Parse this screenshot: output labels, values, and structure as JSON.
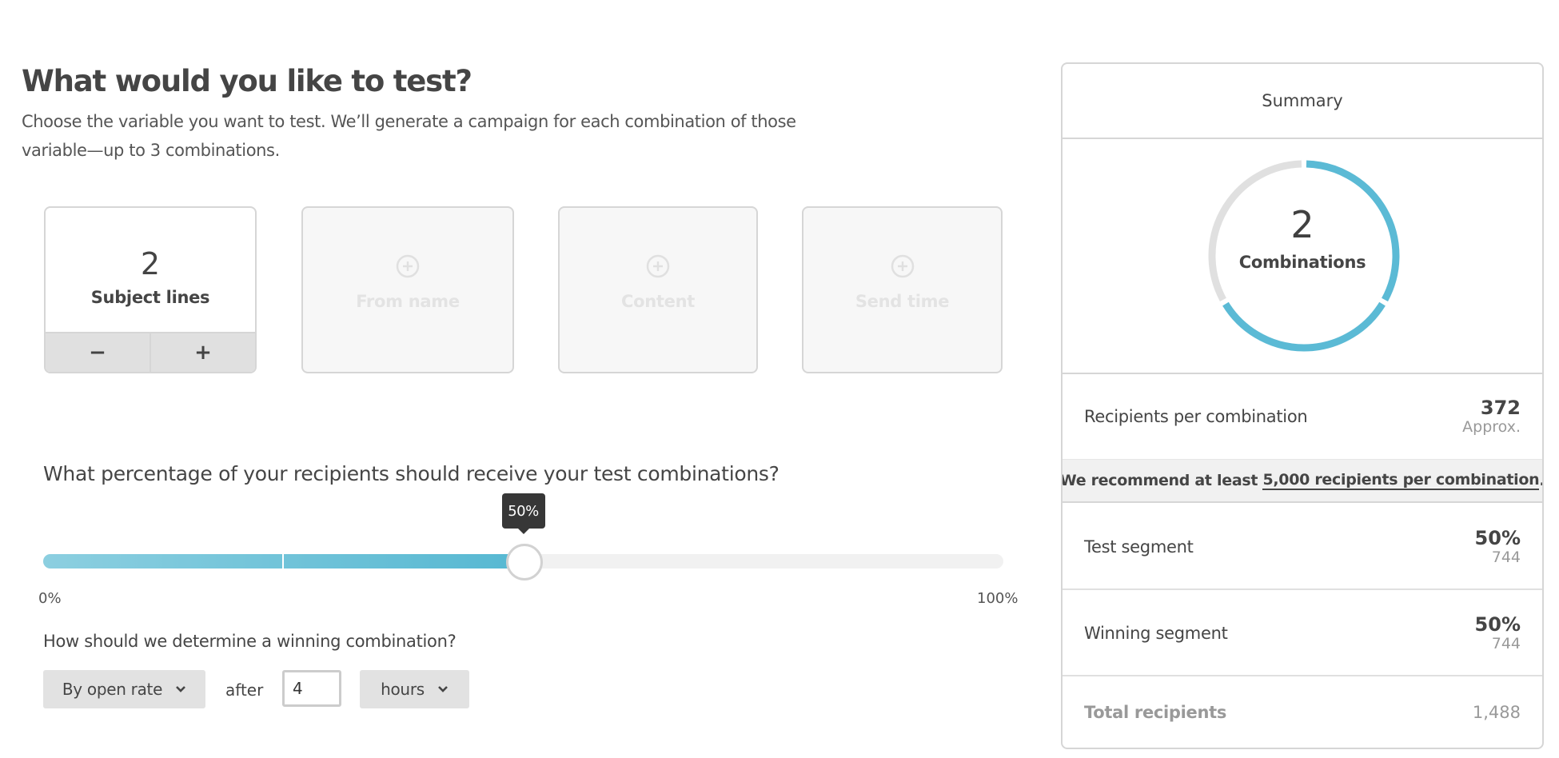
{
  "header": {
    "title": "What would you like to test?",
    "description": "Choose the variable you want to test. We’ll generate a campaign for each combination of those variable—up to 3 combinations."
  },
  "variables": [
    {
      "label": "Subject lines",
      "count": "2",
      "active": true,
      "decrement_label": "−",
      "increment_label": "+"
    },
    {
      "label": "From name",
      "active": false,
      "icon": "plus-circle-icon"
    },
    {
      "label": "Content",
      "active": false,
      "icon": "plus-circle-icon"
    },
    {
      "label": "Send time",
      "active": false,
      "icon": "plus-circle-icon"
    }
  ],
  "test_percentage": {
    "question": "What percentage of your recipients should receive your test combinations?",
    "value_percent": 50,
    "value_label": "50%",
    "min_label": "0%",
    "max_label": "100%",
    "combinations": 2
  },
  "winner": {
    "question": "How should we determine a winning combination?",
    "metric_selected": "By open rate",
    "after_label": "after",
    "duration_value": "4",
    "unit_selected": "hours"
  },
  "summary": {
    "title": "Summary",
    "combinations_count": "2",
    "combinations_label": "Combinations",
    "combinations_max": 3,
    "colors": {
      "filled": "#5bbad5",
      "empty": "#e0e0e0"
    },
    "recipients_per_combination": {
      "label": "Recipients per combination",
      "value": "372",
      "note": "Approx."
    },
    "recommendation": {
      "prefix": "We recommend at least ",
      "link": "5,000 recipients per combination",
      "suffix": "."
    },
    "test_segment": {
      "label": "Test segment",
      "percent": "50%",
      "count": "744"
    },
    "winning_segment": {
      "label": "Winning segment",
      "percent": "50%",
      "count": "744"
    },
    "total_recipients": {
      "label": "Total recipients",
      "value": "1,488"
    }
  }
}
